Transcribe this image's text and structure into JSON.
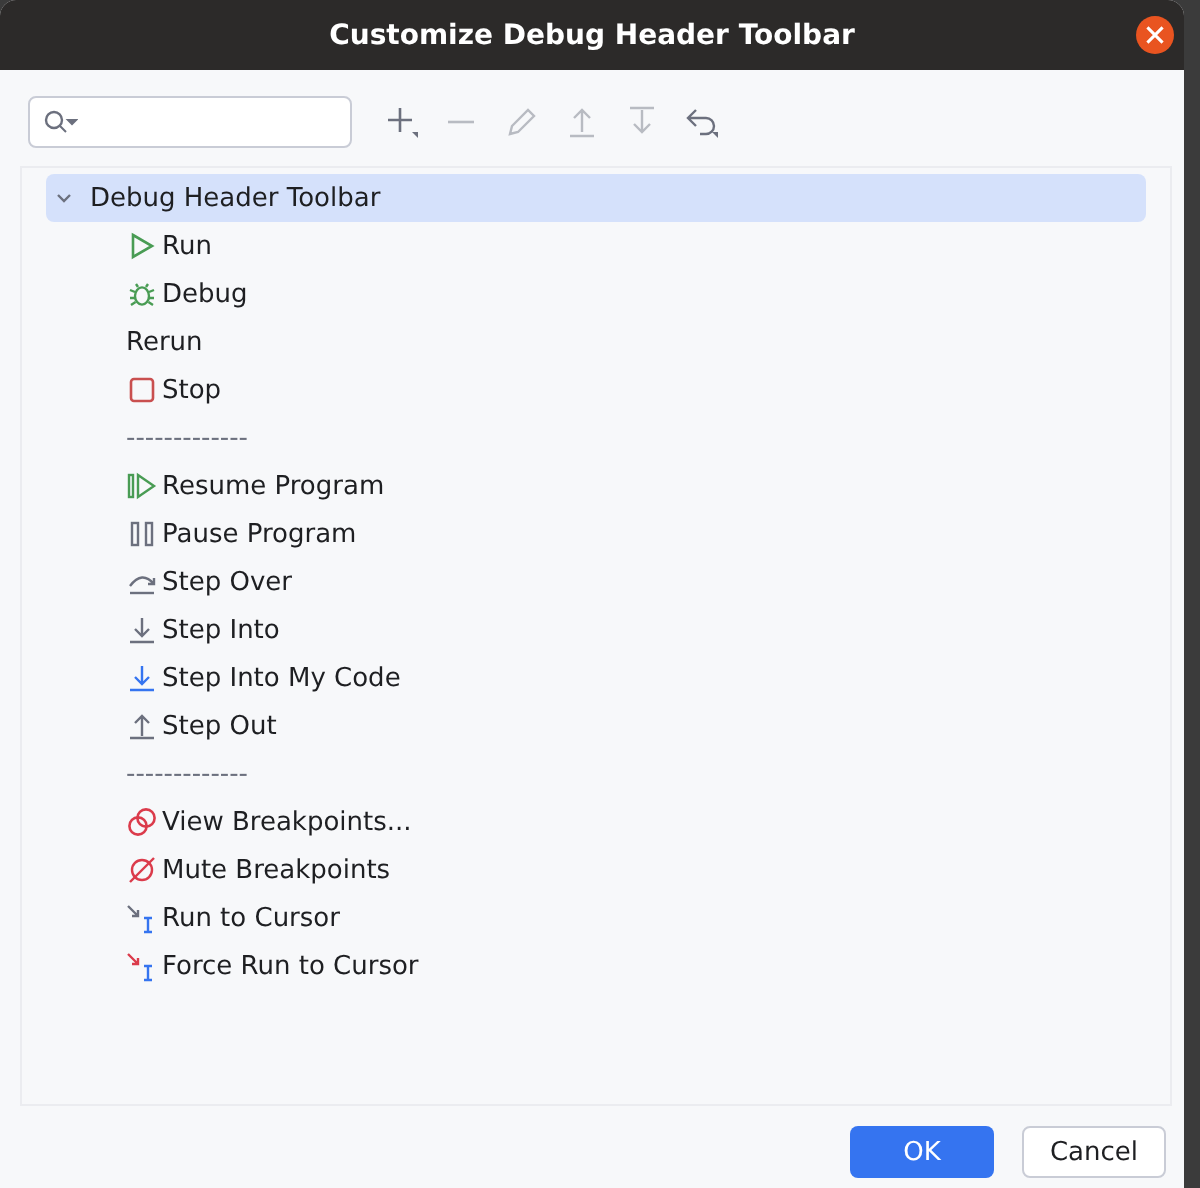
{
  "window": {
    "title": "Customize Debug Header Toolbar"
  },
  "toolbar": [
    {
      "kind": "add",
      "disabled": false
    },
    {
      "kind": "remove",
      "disabled": true
    },
    {
      "kind": "edit",
      "disabled": true
    },
    {
      "kind": "move-up",
      "disabled": true
    },
    {
      "kind": "move-down",
      "disabled": true
    },
    {
      "kind": "restore",
      "disabled": false
    }
  ],
  "tree": {
    "label": "Debug Header Toolbar",
    "expanded": true,
    "selected": true,
    "children": [
      {
        "label": "Run",
        "kind": "run"
      },
      {
        "label": "Debug",
        "kind": "debug"
      },
      {
        "label": "Rerun",
        "kind": "plain"
      },
      {
        "label": "Stop",
        "kind": "stop"
      },
      {
        "label": "-------------",
        "kind": "separator"
      },
      {
        "label": "Resume Program",
        "kind": "resume"
      },
      {
        "label": "Pause Program",
        "kind": "pause"
      },
      {
        "label": "Step Over",
        "kind": "step-over"
      },
      {
        "label": "Step Into",
        "kind": "step-into"
      },
      {
        "label": "Step Into My Code",
        "kind": "step-into-my-code"
      },
      {
        "label": "Step Out",
        "kind": "step-out"
      },
      {
        "label": "-------------",
        "kind": "separator"
      },
      {
        "label": "View Breakpoints...",
        "kind": "view-breakpoints"
      },
      {
        "label": "Mute Breakpoints",
        "kind": "mute-breakpoints"
      },
      {
        "label": "Run to Cursor",
        "kind": "run-to-cursor"
      },
      {
        "label": "Force Run to Cursor",
        "kind": "force-run-to-cursor"
      }
    ]
  },
  "buttons": [
    {
      "label": "OK",
      "kind": "primary"
    },
    {
      "label": "Cancel",
      "kind": "secondary"
    }
  ]
}
